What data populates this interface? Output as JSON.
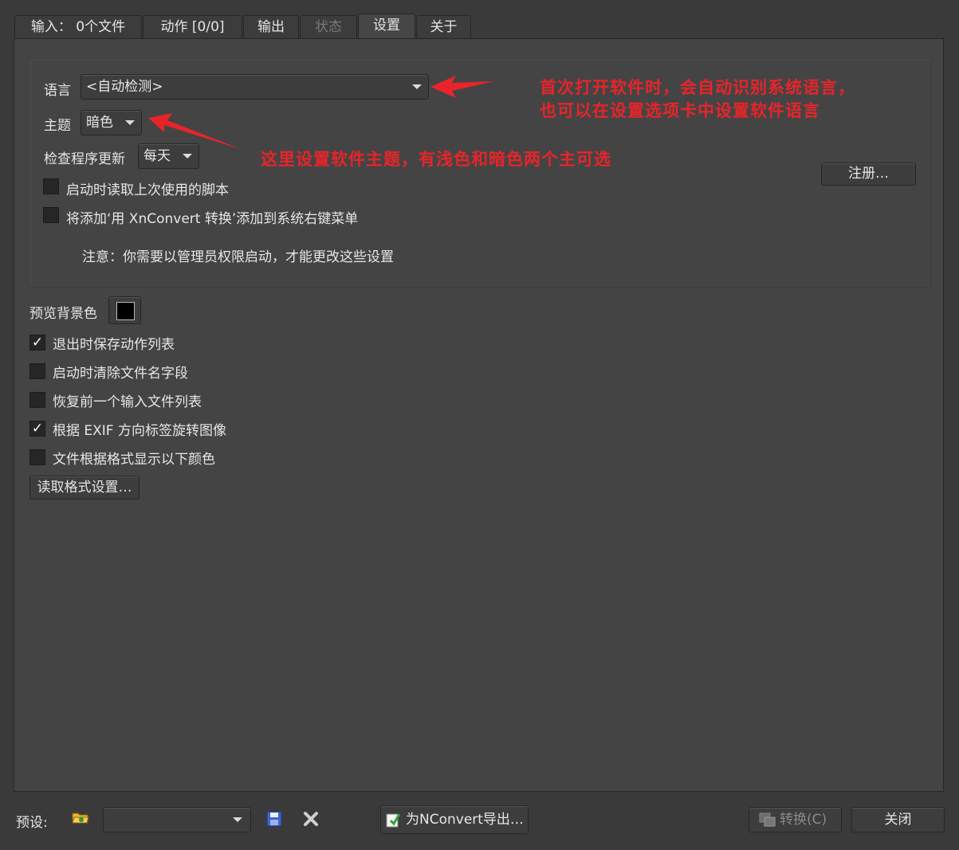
{
  "tabs": [
    {
      "label": "输入： 0个文件"
    },
    {
      "label": "动作 [0/0]"
    },
    {
      "label": "输出"
    },
    {
      "label": "状态"
    },
    {
      "label": "设置"
    },
    {
      "label": "关于"
    }
  ],
  "settings": {
    "language_label": "语言",
    "language_value": "<自动检测>",
    "theme_label": "主题",
    "theme_value": "暗色",
    "update_label": "检查程序更新",
    "update_value": "每天",
    "checkbox_load_script": "启动时读取上次使用的脚本",
    "checkbox_context_menu": "将添加‘用 XnConvert 转换’添加到系统右键菜单",
    "admin_note": "注意：你需要以管理员权限启动，才能更改这些设置",
    "register_label": "注册…"
  },
  "options": {
    "preview_bg_label": "预览背景色",
    "preview_bg_color": "#000000",
    "items": [
      {
        "label": "退出时保存动作列表",
        "checked": true
      },
      {
        "label": "启动时清除文件名字段",
        "checked": false
      },
      {
        "label": "恢复前一个输入文件列表",
        "checked": false
      },
      {
        "label": "根据 EXIF 方向标签旋转图像",
        "checked": true
      },
      {
        "label": "文件根据格式显示以下颜色",
        "checked": false
      }
    ],
    "read_format_label": "读取格式设置…"
  },
  "annotations": {
    "language_note_line1": "首次打开软件时，会自动识别系统语言，",
    "language_note_line2": "也可以在设置选项卡中设置软件语言",
    "theme_note": "这里设置软件主题，有浅色和暗色两个主可选",
    "color": "#e8242a"
  },
  "footer": {
    "preset_label": "预设:",
    "preset_value": "",
    "export_label": "为NConvert导出…",
    "convert_label": "转换(C)",
    "close_label": "关闭"
  },
  "icons": [
    "folder-open-icon",
    "save-icon",
    "delete-icon",
    "export-script-icon",
    "convert-icon"
  ]
}
